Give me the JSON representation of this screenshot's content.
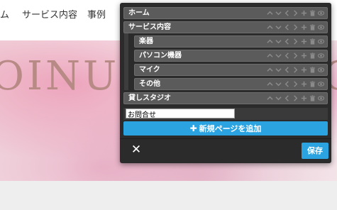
{
  "site": {
    "nav": [
      {
        "label": "ム"
      },
      {
        "label": "サービス内容"
      },
      {
        "label": "事例"
      }
    ],
    "hero_title": "OINU",
    "hero_title_right": "O"
  },
  "menu_editor": {
    "items": [
      {
        "label": "ホーム",
        "level": 0
      },
      {
        "label": "サービス内容",
        "level": 0
      },
      {
        "label": "楽器",
        "level": 1
      },
      {
        "label": "パソコン機器",
        "level": 1
      },
      {
        "label": "マイク",
        "level": 1
      },
      {
        "label": "その他",
        "level": 1
      },
      {
        "label": "貸しスタジオ",
        "level": 0
      }
    ],
    "new_item_value": "お問合せ",
    "add_button_label": "新規ページを追加",
    "save_label": "保存",
    "close_symbol": "✕",
    "row_tool_icons": [
      "arrow-up-icon",
      "arrow-down-icon",
      "indent-left-icon",
      "indent-right-icon",
      "add-icon",
      "delete-icon",
      "visibility-icon"
    ]
  },
  "colors": {
    "accent": "#2aa3e0",
    "panel_bg": "#2b2b2b",
    "row_bg": "#5b5b5b"
  }
}
